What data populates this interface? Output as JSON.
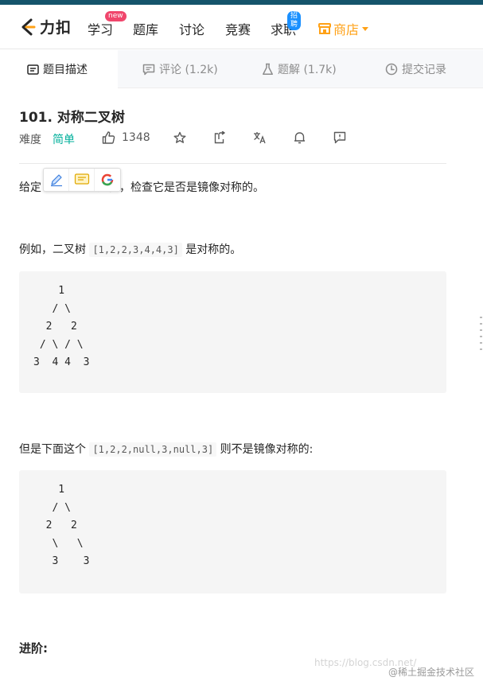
{
  "brand": {
    "name": "力扣"
  },
  "nav": {
    "study": "学习",
    "study_badge": "new",
    "problems": "题库",
    "discuss": "讨论",
    "contest": "竞赛",
    "jobs": "求职",
    "jobs_badge": "招聘",
    "store": "商店"
  },
  "tabs": {
    "description": "题目描述",
    "comments": "评论 (1.2k)",
    "solutions": "题解 (1.7k)",
    "submissions": "提交记录"
  },
  "problem": {
    "title": "101. 对称二叉树",
    "difficulty_label": "难度",
    "difficulty": "简单",
    "likes": "1348",
    "intro_a": "给定",
    "intro_b": "个二叉树，检查它是否是镜像对称的。",
    "example1_pre": "例如，二叉树 ",
    "example1_code": "[1,2,2,3,4,4,3]",
    "example1_post": " 是对称的。",
    "tree1": "    1\n   / \\\n  2   2\n / \\ / \\\n3  4 4  3",
    "example2_pre": "但是下面这个 ",
    "example2_code": "[1,2,2,null,3,null,3]",
    "example2_post": " 则不是镜像对称的:",
    "tree2": "    1\n   / \\\n  2   2\n   \\   \\\n   3    3",
    "advanced": "进阶:"
  },
  "watermark": {
    "url": "https://blog.csdn.net/",
    "community": "@稀土掘金技术社区"
  },
  "colors": {
    "accent": "#ffa116",
    "easy": "#00af9b",
    "top_strip": "#15546b"
  }
}
